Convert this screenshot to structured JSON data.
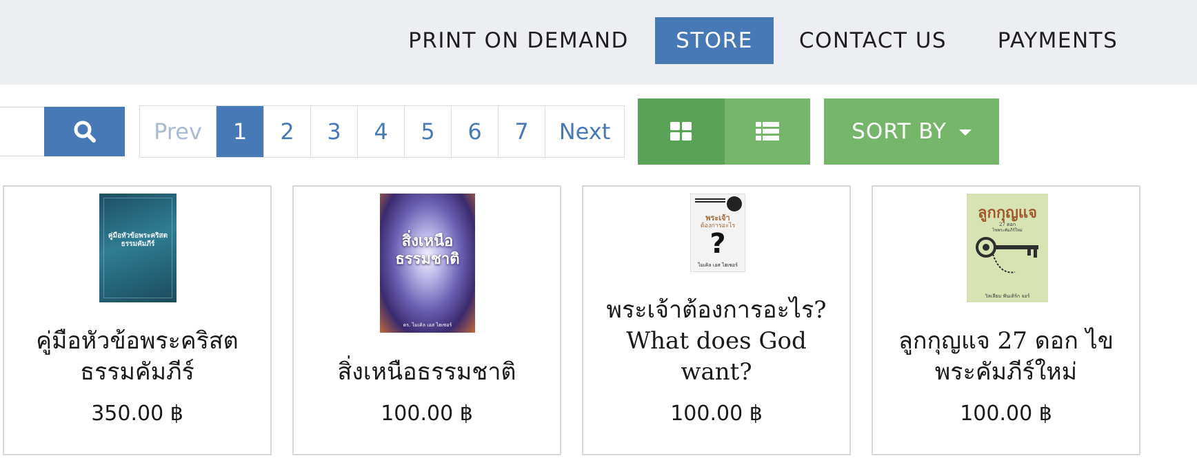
{
  "nav": {
    "items": [
      {
        "label": "PRINT ON DEMAND"
      },
      {
        "label": "STORE"
      },
      {
        "label": "CONTACT US"
      },
      {
        "label": "PAYMENTS"
      }
    ],
    "active": "STORE"
  },
  "toolbar": {
    "search_icon": "search-icon",
    "pagination": {
      "prev": "Prev",
      "pages": [
        "1",
        "2",
        "3",
        "4",
        "5",
        "6",
        "7"
      ],
      "current": "1",
      "next": "Next"
    },
    "view_grid_icon": "grid-view-icon",
    "view_list_icon": "list-view-icon",
    "sort_label": "SORT BY"
  },
  "products": [
    {
      "title_line1": "คู่มือหัวข้อพระคริสต",
      "title_line2": "ธรรมคัมภีร์",
      "price": "350.00 ฿",
      "cover": {
        "title": "คู่มือหัวข้อพระคริสตธรรมคัมภีร์",
        "color": "#2a6a80"
      }
    },
    {
      "title_line1": "สิ่งเหนือธรรมชาติ",
      "price": "100.00 ฿",
      "cover": {
        "title_line1": "สิ่งเหนือ",
        "title_line2": "ธรรมชาติ",
        "author": "ดร. ไมเคิล เอส ไฮเซอร์",
        "color": "#5a3a86"
      }
    },
    {
      "title_line1": "พระเจ้าต้องการอะไร?",
      "title_line2": "What does God",
      "title_line3": "want?",
      "price": "100.00 ฿",
      "cover": {
        "title_line1": "พระเจ้า",
        "title_line2": "ต้องการอะไร",
        "mark": "?",
        "author": "ไมเคิล เอส ไฮเซอร์",
        "color": "#f3f3f3"
      }
    },
    {
      "title_line1": "ลูกกุญแจ 27 ดอก ไข",
      "title_line2": "พระคัมภีร์ใหม่",
      "price": "100.00 ฿",
      "cover": {
        "title_line1": "ลูกกุญแจ",
        "title_line2": "27 ดอก",
        "subtitle": "ไขพระคัมภีร์ใหม่",
        "author": "วิลเลียม ฟันเดิร์ก จอร์",
        "color": "#d8e3b4"
      }
    }
  ]
}
